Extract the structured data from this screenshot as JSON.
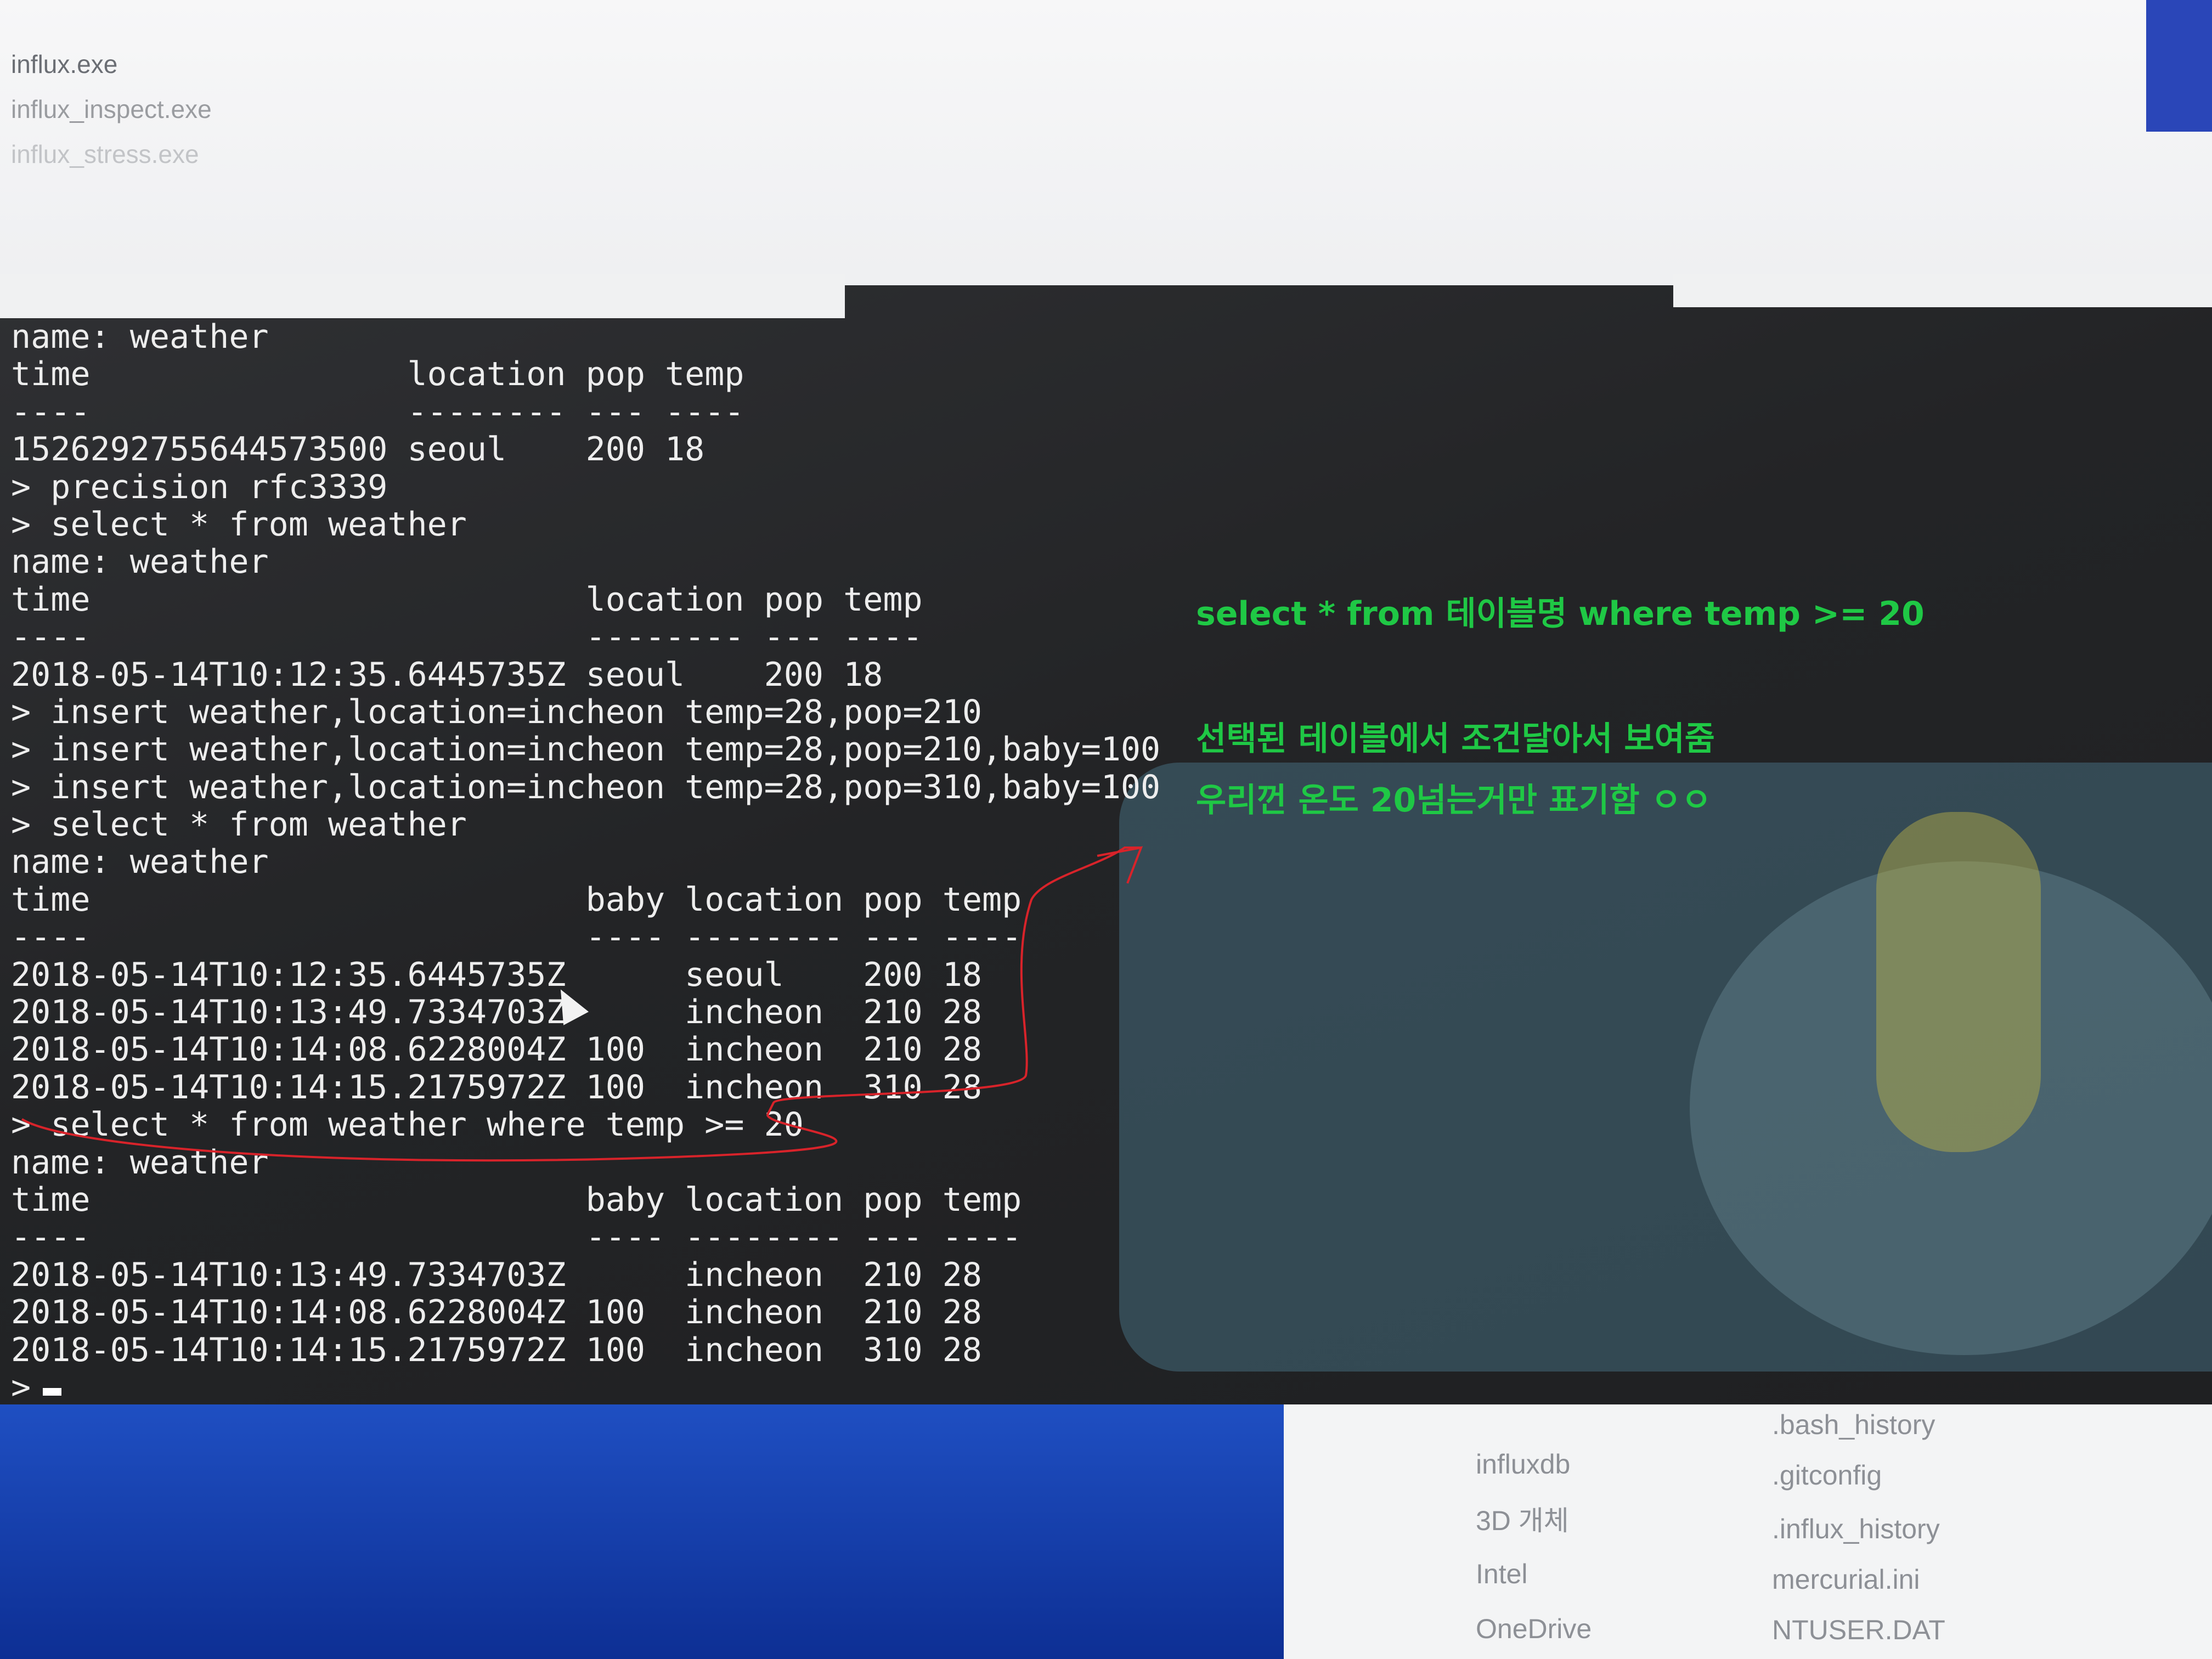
{
  "explorer_top": {
    "files": [
      "influx.exe",
      "influx_inspect.exe",
      "influx_stress.exe"
    ]
  },
  "terminal": {
    "lines": [
      "name: weather",
      "time                location pop temp",
      "----                -------- --- ----",
      "1526292755644573500 seoul    200 18",
      "> precision rfc3339",
      "> select * from weather",
      "name: weather",
      "time                         location pop temp",
      "----                         -------- --- ----",
      "2018-05-14T10:12:35.6445735Z seoul    200 18",
      "> insert weather,location=incheon temp=28,pop=210",
      "> insert weather,location=incheon temp=28,pop=210,baby=100",
      "> insert weather,location=incheon temp=28,pop=310,baby=100",
      "> select * from weather",
      "name: weather",
      "time                         baby location pop temp",
      "----                         ---- -------- --- ----",
      "2018-05-14T10:12:35.6445735Z      seoul    200 18",
      "2018-05-14T10:13:49.7334703Z      incheon  210 28",
      "2018-05-14T10:14:08.6228004Z 100  incheon  210 28",
      "2018-05-14T10:14:15.2175972Z 100  incheon  310 28",
      "> select * from weather where temp >= 20",
      "name: weather",
      "time                         baby location pop temp",
      "----                         ---- -------- --- ----",
      "2018-05-14T10:13:49.7334703Z      incheon  210 28",
      "2018-05-14T10:14:08.6228004Z 100  incheon  210 28",
      "2018-05-14T10:14:15.2175972Z 100  incheon  310 28",
      ">"
    ]
  },
  "annotation": {
    "query": "select * from 테이블명 where temp >= 20",
    "line1": "선택된 테이블에서 조건달아서 보여줌",
    "line2": "우리껀 온도 20넘는거만 표기함 ㅇㅇ",
    "color": "#1fc845",
    "highlight_color": "#d8232a"
  },
  "explorer_bottom": {
    "folders": [
      "influxdb",
      "3D 개체",
      "Intel",
      "OneDrive"
    ],
    "files": [
      ".bash_history",
      ".gitconfig",
      ".influx_history",
      "mercurial.ini",
      "NTUSER.DAT"
    ]
  }
}
